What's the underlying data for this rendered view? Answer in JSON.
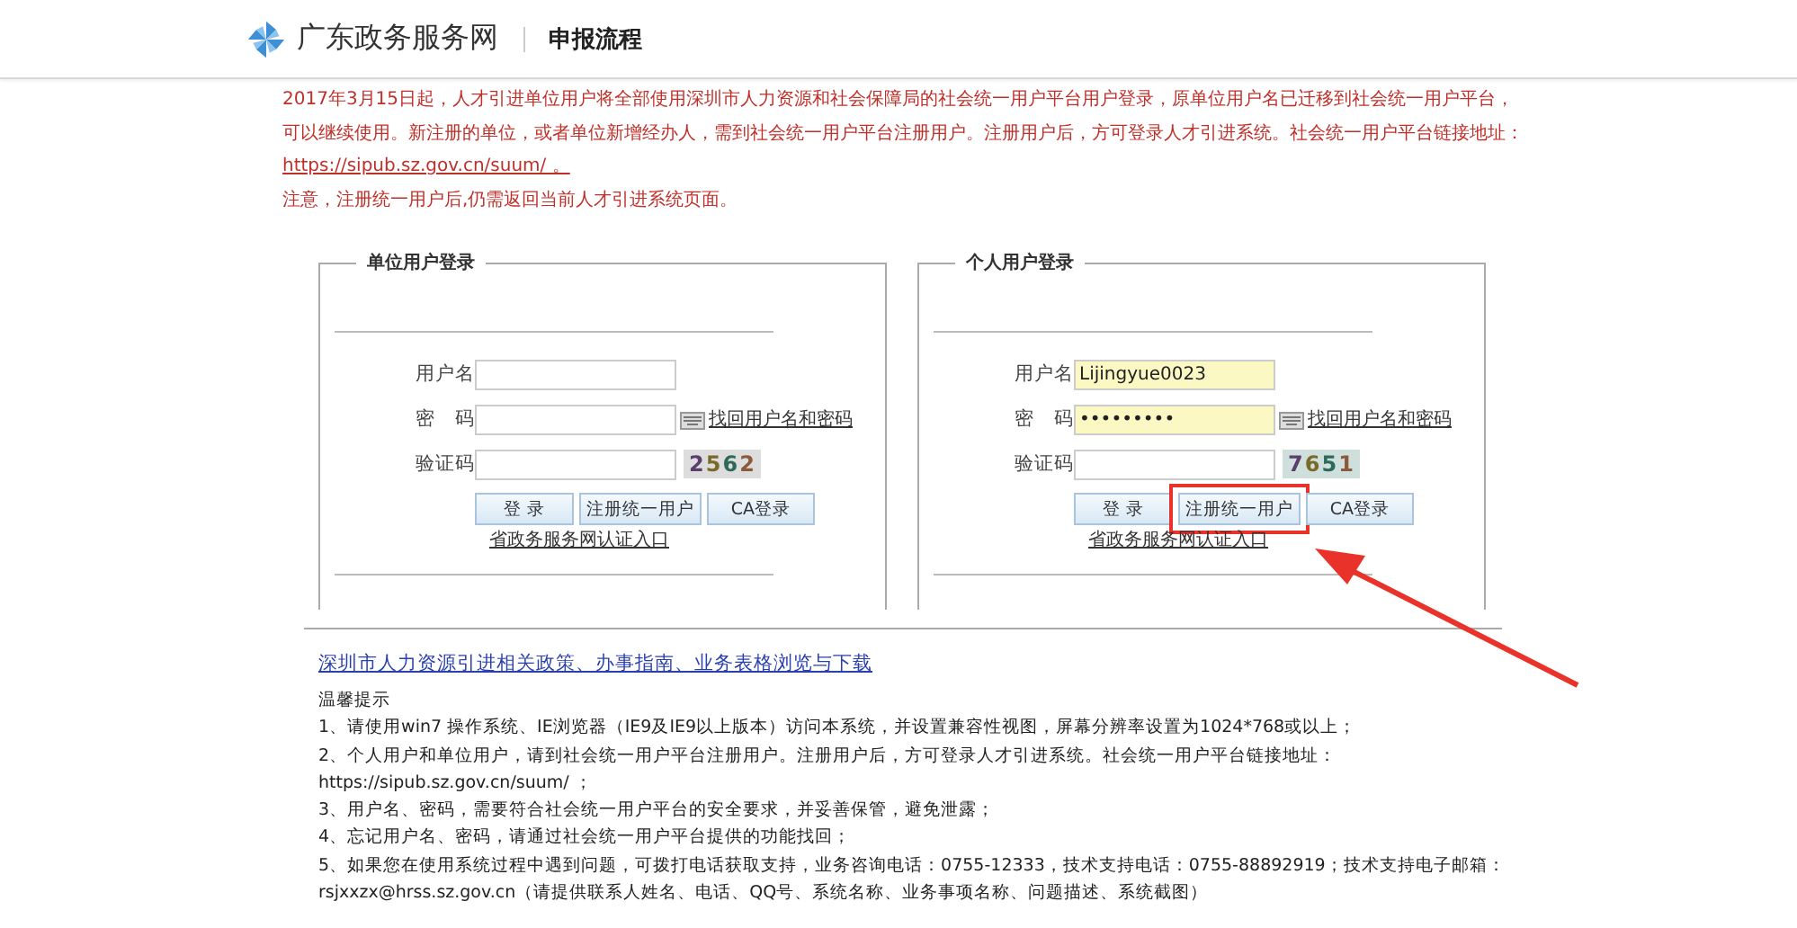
{
  "header": {
    "site_name": "广东政务服务网",
    "page_title": "申报流程"
  },
  "notice": {
    "text": "2017年3月15日起，人才引进单位用户将全部使用深圳市人力资源和社会保障局的社会统一用户平台用户登录，原单位用户名已迁移到社会统一用户平台，可以继续使用。新注册的单位，或者单位新增经办人，需到社会统一用户平台注册用户。注册用户后，方可登录人才引进系统。社会统一用户平台链接地址：",
    "link": "https://sipub.sz.gov.cn/suum/",
    "link_suffix": " 。",
    "note": "注意，注册统一用户后,仍需返回当前人才引进系统页面。"
  },
  "panels": [
    {
      "title": "单位用户登录",
      "username_label": "用户名",
      "password_label": "密　码",
      "forgot_link": "找回用户名和密码",
      "captcha_label": "验证码",
      "captcha": "2562",
      "buttons": [
        {
          "label": "登 录",
          "highlighted": false
        },
        {
          "label": "注册统一用户",
          "highlighted": false
        },
        {
          "label": "CA登录",
          "highlighted": false
        }
      ],
      "portal_link": "省政务服务网认证入口"
    },
    {
      "title": "个人用户登录",
      "username_label": "用户名",
      "username": "Lijingyue0023",
      "password_label": "密　码",
      "password": "•••••••••",
      "forgot_link": "找回用户名和密码",
      "captcha_label": "验证码",
      "captcha": "7651",
      "buttons": [
        {
          "label": "登 录",
          "highlighted": false
        },
        {
          "label": "注册统一用户",
          "highlighted": true
        },
        {
          "label": "CA登录",
          "highlighted": false
        }
      ],
      "portal_link": "省政务服务网认证入口"
    }
  ],
  "resources_link": "深圳市人力资源引进相关政策、办事指南、业务表格浏览与下载",
  "tips": {
    "title": "温馨提示",
    "lines": [
      "1、请使用win7 操作系统、IE浏览器（IE9及IE9以上版本）访问本系统，并设置兼容性视图，屏幕分辨率设置为1024*768或以上；",
      "2、个人用户和单位用户，请到社会统一用户平台注册用户。注册用户后，方可登录人才引进系统。社会统一用户平台链接地址：",
      "https://sipub.sz.gov.cn/suum/ ；",
      "3、用户名、密码，需要符合社会统一用户平台的安全要求，并妥善保管，避免泄露；",
      "4、忘记用户名、密码，请通过社会统一用户平台提供的功能找回；",
      "5、如果您在使用系统过程中遇到问题，可拨打电话获取支持，业务咨询电话：0755-12333，技术支持电话：0755-88892919；技术支持电子邮箱：",
      "rsjxxzx@hrss.sz.gov.cn（请提供联系人姓名、电话、QQ号、系统名称、业务事项名称、问题描述、系统截图）"
    ]
  }
}
